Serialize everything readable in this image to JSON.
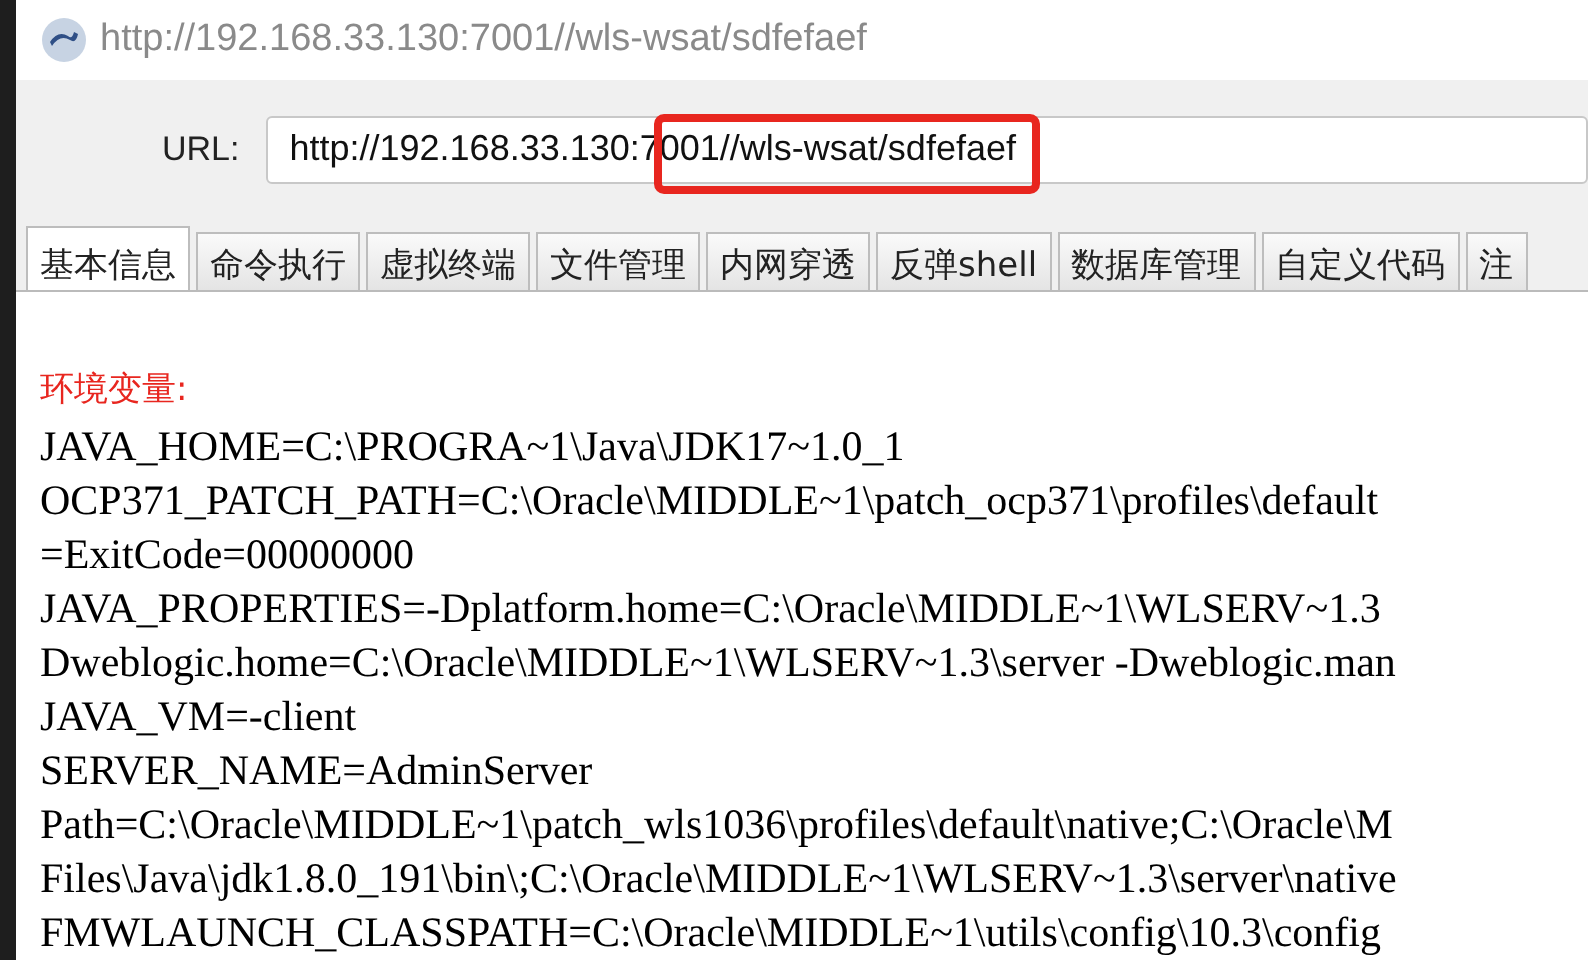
{
  "window": {
    "title": "http://192.168.33.130:7001//wls-wsat/sdfefaef"
  },
  "url_bar": {
    "label": "URL:",
    "value": "http://192.168.33.130:7001//wls-wsat/sdfefaef"
  },
  "tabs": [
    {
      "label": "基本信息",
      "selected": true
    },
    {
      "label": "命令执行",
      "selected": false
    },
    {
      "label": "虚拟终端",
      "selected": false
    },
    {
      "label": "文件管理",
      "selected": false
    },
    {
      "label": "内网穿透",
      "selected": false
    },
    {
      "label": "反弹shell",
      "selected": false
    },
    {
      "label": "数据库管理",
      "selected": false
    },
    {
      "label": "自定义代码",
      "selected": false
    },
    {
      "label": "注",
      "selected": false
    }
  ],
  "content": {
    "heading": "环境变量:",
    "lines": [
      "JAVA_HOME=C:\\PROGRA~1\\Java\\JDK17~1.0_1",
      "OCP371_PATCH_PATH=C:\\Oracle\\MIDDLE~1\\patch_ocp371\\profiles\\default",
      "=ExitCode=00000000",
      "JAVA_PROPERTIES=-Dplatform.home=C:\\Oracle\\MIDDLE~1\\WLSERV~1.3",
      "Dweblogic.home=C:\\Oracle\\MIDDLE~1\\WLSERV~1.3\\server -Dweblogic.man",
      "JAVA_VM=-client",
      "SERVER_NAME=AdminServer",
      "Path=C:\\Oracle\\MIDDLE~1\\patch_wls1036\\profiles\\default\\native;C:\\Oracle\\M",
      "Files\\Java\\jdk1.8.0_191\\bin\\;C:\\Oracle\\MIDDLE~1\\WLSERV~1.3\\server\\native",
      "FMWLAUNCH_CLASSPATH=C:\\Oracle\\MIDDLE~1\\utils\\config\\10.3\\config"
    ]
  }
}
